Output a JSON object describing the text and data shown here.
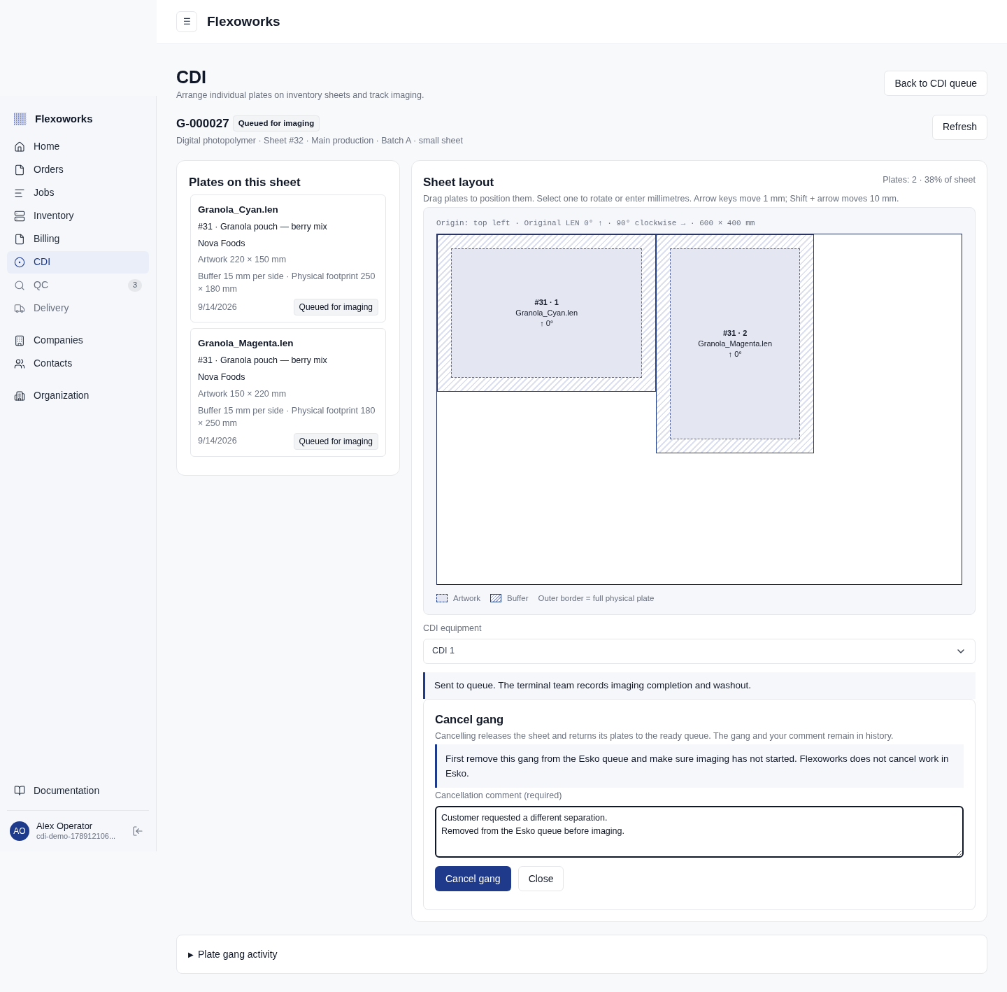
{
  "header": {
    "menu_button": "☰",
    "title": "Flexoworks"
  },
  "sidebar": {
    "brand": "Flexoworks",
    "groups": [
      [
        {
          "label": "Home",
          "kind": "home",
          "selected": false,
          "disabled": false
        },
        {
          "label": "Orders",
          "kind": "file",
          "selected": false,
          "disabled": false
        },
        {
          "label": "Jobs",
          "kind": "lines",
          "selected": false,
          "disabled": false
        },
        {
          "label": "Inventory",
          "kind": "stack",
          "selected": false,
          "disabled": false
        },
        {
          "label": "Billing",
          "kind": "file",
          "selected": false,
          "disabled": false
        },
        {
          "label": "CDI",
          "kind": "target",
          "selected": true,
          "disabled": false
        },
        {
          "label": "QC",
          "kind": "search",
          "selected": false,
          "disabled": true,
          "badge": "3"
        },
        {
          "label": "Delivery",
          "kind": "truck",
          "selected": false,
          "disabled": true
        }
      ],
      [
        {
          "label": "Companies",
          "kind": "building",
          "selected": false,
          "disabled": false
        },
        {
          "label": "Contacts",
          "kind": "users",
          "selected": false,
          "disabled": false
        }
      ],
      [
        {
          "label": "Organization",
          "kind": "org",
          "selected": false,
          "disabled": false
        }
      ]
    ],
    "documentation": "Documentation",
    "user": {
      "initials": "AO",
      "name": "Alex Operator",
      "id": "cdi-demo-178912106..."
    }
  },
  "page": {
    "title": "CDI",
    "subtitle": "Arrange individual plates on inventory sheets and track imaging.",
    "back_button": "Back to CDI queue",
    "gang": {
      "code": "G-000027",
      "status": "Queued for imaging",
      "meta": "Digital photopolymer · Sheet #32 · Main production · Batch A · small sheet",
      "refresh_button": "Refresh"
    }
  },
  "plates_panel": {
    "title": "Plates on this sheet",
    "plates": [
      {
        "name": "Granola_Cyan.len",
        "job": "#31 · Granola pouch — berry mix",
        "company": "Nova Foods",
        "artwork": "Artwork 220 × 150 mm",
        "buffer": "Buffer 15 mm per side · Physical footprint 250 × 180 mm",
        "date": "9/14/2026",
        "status": "Queued for imaging"
      },
      {
        "name": "Granola_Magenta.len",
        "job": "#31 · Granola pouch — berry mix",
        "company": "Nova Foods",
        "artwork": "Artwork 150 × 220 mm",
        "buffer": "Buffer 15 mm per side · Physical footprint 180 × 250 mm",
        "date": "9/14/2026",
        "status": "Queued for imaging"
      }
    ]
  },
  "layout_panel": {
    "title": "Sheet layout",
    "summary": "Plates: 2 · 38% of sheet",
    "hint": "Drag plates to position them. Select one to rotate or enter millimetres. Arrow keys move 1 mm; Shift + arrow moves 10 mm.",
    "origin": "Origin: top left · Original LEN 0° ↑ · 90° clockwise → · 600 × 400 mm",
    "plates": [
      {
        "label": "#31 · 1",
        "name": "Granola_Cyan.len",
        "rotation": "↑ 0°"
      },
      {
        "label": "#31 · 2",
        "name": "Granola_Magenta.len",
        "rotation": "↑ 0°"
      }
    ],
    "legend": {
      "artwork": "Artwork",
      "buffer": "Buffer",
      "note": "Outer border = full physical plate"
    },
    "equipment_label": "CDI equipment",
    "equipment_value": "CDI 1",
    "notice": "Sent to queue. The terminal team records imaging completion and washout.",
    "cancel": {
      "title": "Cancel gang",
      "description": "Cancelling releases the sheet and returns its plates to the ready queue. The gang and your comment remain in history.",
      "warning": "First remove this gang from the Esko queue and make sure imaging has not started. Flexoworks does not cancel work in Esko.",
      "comment_label": "Cancellation comment (required)",
      "comment_value": "Customer requested a different separation.\nRemoved from the Esko queue before imaging.",
      "confirm_button": "Cancel gang",
      "close_button": "Close"
    }
  },
  "activity": {
    "marker": "▶",
    "label": "Plate gang activity"
  }
}
